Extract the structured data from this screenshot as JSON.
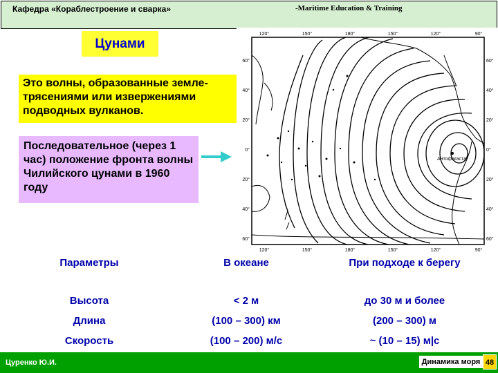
{
  "header": {
    "department": "Кафедра «Кораблестроение и сварка»",
    "program": "-Maritime Education & Training"
  },
  "title": "Цунами",
  "definition": "Это волны, образованные земле-трясениями или извержениями подводных вулканов.",
  "caption": "Последовательное (через 1 час) положение фронта волны Чилийского цунами в 1960 году",
  "map": {
    "top_longitudes": [
      "120°",
      "150°",
      "180°",
      "150°",
      "120°",
      "90°"
    ],
    "bottom_longitudes": [
      "120°",
      "150°",
      "180°",
      "150°",
      "120°",
      "90°"
    ],
    "left_latitudes": [
      "60°",
      "40°",
      "20°",
      "0°",
      "20°",
      "40°",
      "60°"
    ],
    "right_latitudes": [
      "60°",
      "40°",
      "20°",
      "0°",
      "20°",
      "40°",
      "60°"
    ],
    "place_label": "Антофагаста"
  },
  "table": {
    "headers": [
      "Параметры",
      "В океане",
      "При подходе к берегу"
    ],
    "rows": [
      [
        "Высота",
        "< 2 м",
        "до 30 м и более"
      ],
      [
        "Длина",
        "(100 – 300) км",
        "(200 – 300) м"
      ],
      [
        "Скорость",
        "(100 – 200) м/с",
        "~ (10 – 15) м|с"
      ]
    ]
  },
  "footer": {
    "author": "Цуренко Ю.И.",
    "course": "Динамика моря",
    "page": "48"
  },
  "colors": {
    "header_bg": "#d5efd0",
    "title_bg": "#ffff33",
    "definition_bg": "#ffff00",
    "caption_bg": "#e9b9ff",
    "table_text": "#0000aa",
    "footer_bg": "#00a000",
    "arrow": "#33cccc"
  }
}
